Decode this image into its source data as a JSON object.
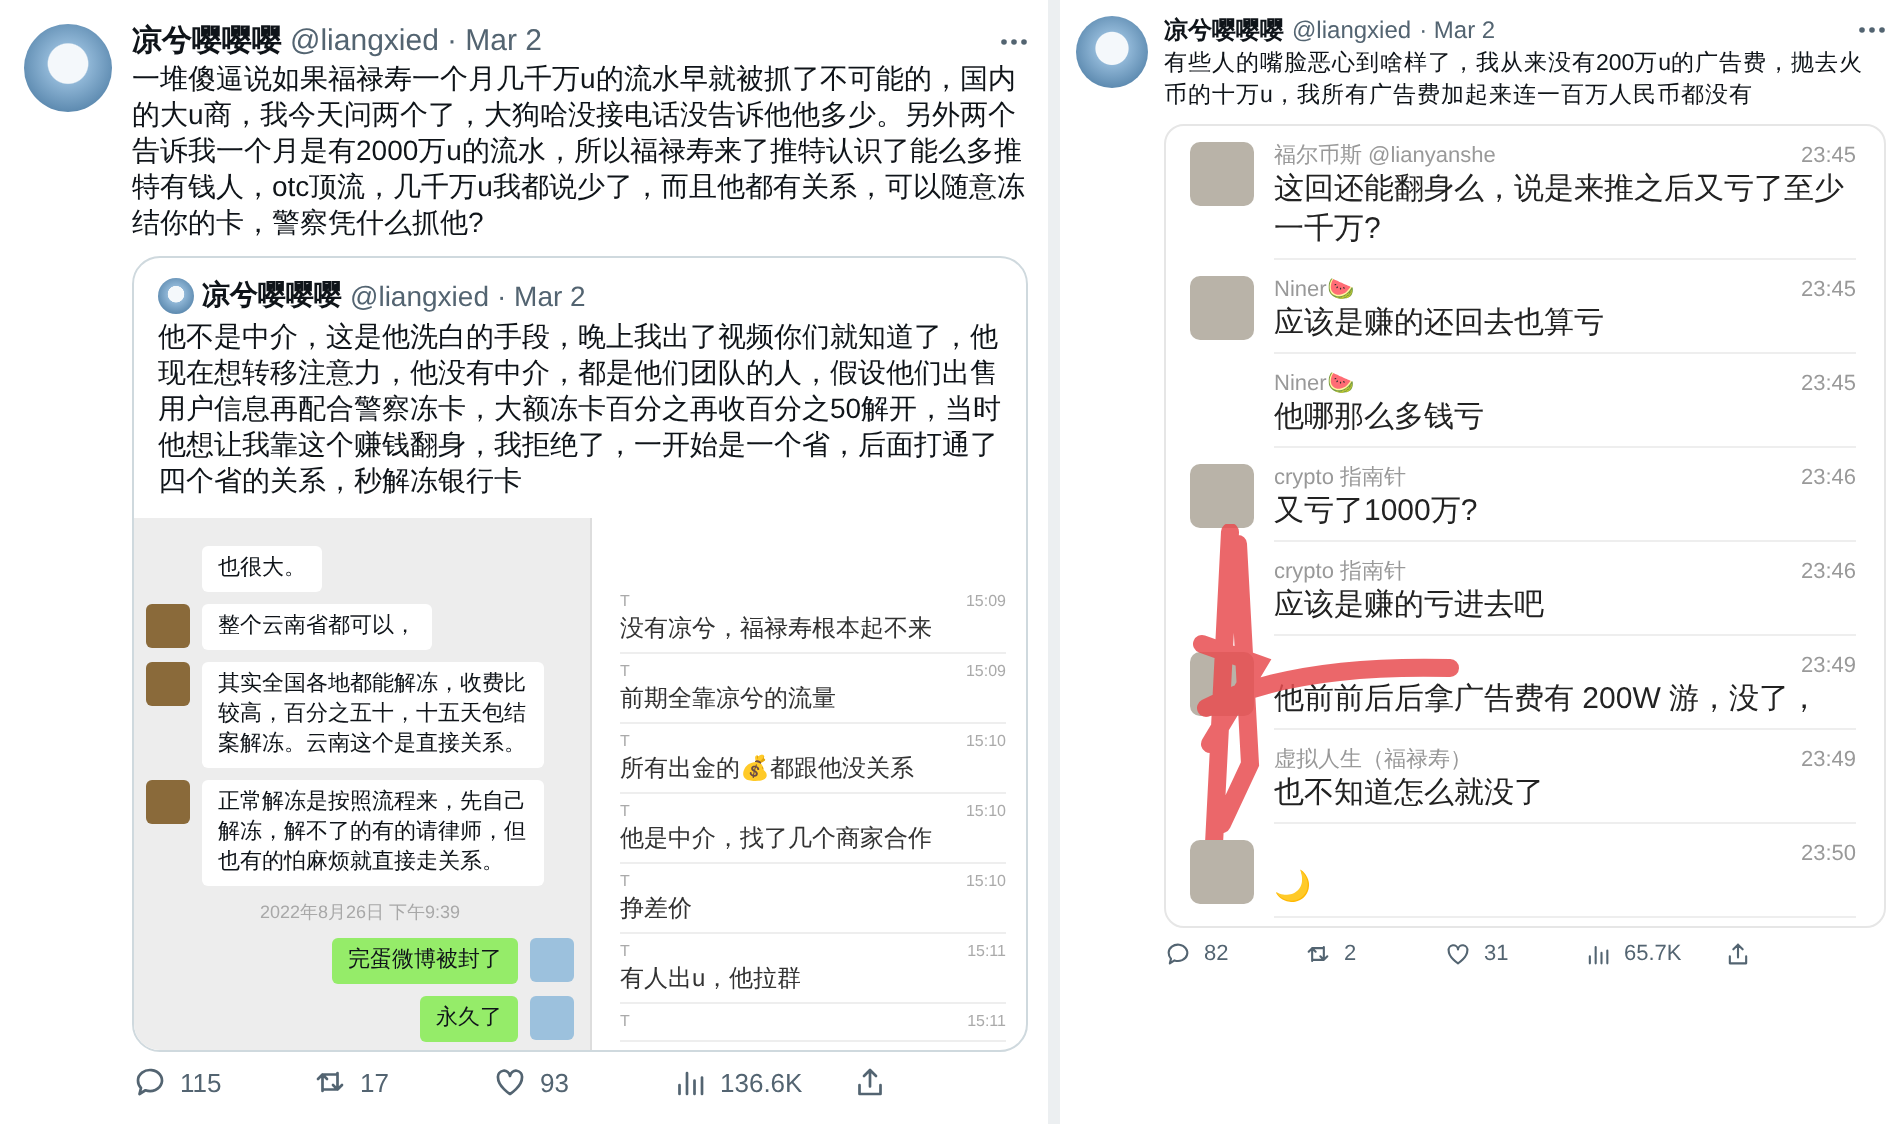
{
  "tweets": [
    {
      "author": "凉兮嘤嘤嘤",
      "handle": "@liangxied",
      "date": "· Mar 2",
      "text": "一堆傻逼说如果福禄寿一个月几千万u的流水早就被抓了不可能的，国内的大u商，我今天问两个了，大狗哈没接电话没告诉他他多少。另外两个告诉我一个月是有2000万u的流水，所以福禄寿来了推特认识了能么多推特有钱人，otc顶流，几千万u我都说少了，而且他都有关系，可以随意冻结你的卡，警察凭什么抓他?",
      "quote": {
        "author": "凉兮嘤嘤嘤",
        "handle": "@liangxied",
        "date": "· Mar 2",
        "text": "他不是中介，这是他洗白的手段，晚上我出了视频你们就知道了，他现在想转移注意力，他没有中介，都是他们团队的人，假设他们出售用户信息再配合警察冻卡，大额冻卡百分之再收百分之50解开，当时他想让我靠这个赚钱翻身，我拒绝了，一开始是一个省，后面打通了四个省的关系，秒解冻银行卡",
        "chat_left": [
          {
            "kind": "received",
            "avatar": false,
            "text": "也很大。"
          },
          {
            "kind": "received",
            "avatar": true,
            "text": "整个云南省都可以，"
          },
          {
            "kind": "received",
            "avatar": true,
            "text": "其实全国各地都能解冻，收费比较高，百分之五十，十五天包结案解冻。云南这个是直接关系。"
          },
          {
            "kind": "received",
            "avatar": true,
            "text": "正常解冻是按照流程来，先自己解冻，解不了的有的请律师，但也有的怕麻烦就直接走关系。"
          },
          {
            "kind": "timestamp",
            "text": "2022年8月26日 下午9:39"
          },
          {
            "kind": "sent",
            "avatar": true,
            "text": "完蛋微博被封了"
          },
          {
            "kind": "sent",
            "avatar": true,
            "text": "永久了"
          }
        ],
        "chat_right": [
          {
            "sender": "T",
            "time": "15:09",
            "text": "没有凉兮，福禄寿根本起不来"
          },
          {
            "sender": "T",
            "time": "15:09",
            "text": "前期全靠凉兮的流量"
          },
          {
            "sender": "T",
            "time": "15:10",
            "text": "所有出金的💰都跟他没关系"
          },
          {
            "sender": "T",
            "time": "15:10",
            "text": "他是中介，找了几个商家合作"
          },
          {
            "sender": "T",
            "time": "15:10",
            "text": "挣差价"
          },
          {
            "sender": "T",
            "time": "15:11",
            "text": "有人出u，他拉群"
          },
          {
            "sender": "T",
            "time": "15:11"
          }
        ]
      },
      "actions": {
        "replies": "115",
        "retweets": "17",
        "likes": "93",
        "views": "136.6K"
      }
    },
    {
      "author": "凉兮嘤嘤嘤",
      "handle": "@liangxied",
      "date": "· Mar 2",
      "text": "有些人的嘴脸恶心到啥样了，我从来没有200万u的广告费，抛去火币的十万u，我所有广告费加起来连一百万人民币都没有",
      "chat": [
        {
          "avatar": true,
          "name": "福尔币斯 @lianyanshe",
          "time": "23:45",
          "text": "这回还能翻身么，说是来推之后又亏了至少一千万?",
          "redacted": false
        },
        {
          "avatar": true,
          "name": "Niner🍉",
          "time": "23:45",
          "text": "应该是赚的还回去也算亏",
          "redacted": false
        },
        {
          "avatar": false,
          "name": "Niner🍉",
          "time": "23:45",
          "text": "他哪那么多钱亏",
          "redacted": false
        },
        {
          "avatar": true,
          "name": "crypto 指南针",
          "time": "23:46",
          "text": "又亏了1000万?",
          "redacted": false
        },
        {
          "avatar": false,
          "name": "crypto 指南针",
          "time": "23:46",
          "text": "应该是赚的亏进去吧",
          "redacted": false
        },
        {
          "avatar": true,
          "time": "23:49",
          "text": "他前前后后拿广告费有 200W 游，没了，",
          "redacted": true
        },
        {
          "avatar": false,
          "name": "虚拟人生（福禄寿）",
          "time": "23:49",
          "text": "也不知道怎么就没了",
          "redacted": false
        },
        {
          "avatar": true,
          "time": "23:50",
          "text": "🌙",
          "redacted": false
        }
      ],
      "actions": {
        "replies": "82",
        "retweets": "2",
        "likes": "31",
        "views": "65.7K"
      }
    }
  ]
}
